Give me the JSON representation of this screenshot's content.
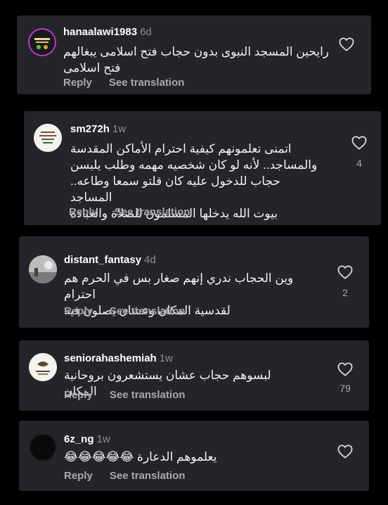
{
  "comments": [
    {
      "username": "hanaalawi1983",
      "time": "6d",
      "text_lines": [
        "رايحين المسجد النبوى بدون حجاب فتح اسلامى يبغالهم",
        "فتح اسلامى"
      ],
      "reply_label": "Reply",
      "translate_label": "See translation",
      "likes": ""
    },
    {
      "username": "sm272h",
      "time": "1w",
      "text_lines": [
        "اتمنى تعلمونهم كيفية احترام الأماكن المقدسة",
        "والمساجد.. لأنه لو كان شخصيه مهمه وطلب يلبسن",
        "حجاب للدخول عليه كان قلتو سمعا وطاعه.. المساجد",
        "بيوت الله يدخلها المسلمون للصلاة والعباده"
      ],
      "reply_label": "Reply",
      "translate_label": "See translation",
      "likes": "4"
    },
    {
      "username": "distant_fantasy",
      "time": "4d",
      "text_lines": [
        "وين الحجاب ندري إنهم صغار بس في الحرم هم احترام",
        "لقدسية المكان وعشان يصلون فيه"
      ],
      "reply_label": "Reply",
      "translate_label": "See translation",
      "likes": "2"
    },
    {
      "username": "seniorahashemiah",
      "time": "1w",
      "text_lines": [
        "لبسوهم حجاب عشان يستشعرون بروحانية المكان"
      ],
      "reply_label": "Reply",
      "translate_label": "See translation",
      "likes": "79"
    },
    {
      "username": "6z_ng",
      "time": "1w",
      "text_lines": [
        "يعلموهم الدعارة 😂😂😂😂😂"
      ],
      "reply_label": "Reply",
      "translate_label": "See translation",
      "likes": ""
    }
  ],
  "colors": {
    "card": "#24252a",
    "background": "#000000",
    "muted": "#a8a8ad"
  }
}
